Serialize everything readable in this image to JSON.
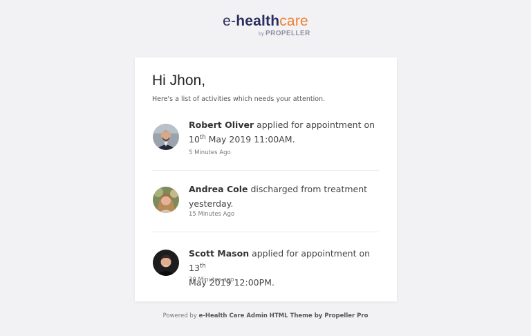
{
  "brand": {
    "logo_e": "e-",
    "logo_health": "health",
    "logo_care": "care",
    "sub_by": "by",
    "sub_name": "PROPELLER",
    "colors": {
      "navy": "#2a2d5e",
      "orange": "#f07f2d"
    }
  },
  "card": {
    "greeting": "Hi Jhon,",
    "intro": "Here's a list of activities which needs your attention."
  },
  "activities": [
    {
      "name": "Robert Oliver",
      "action": " applied for appointment on",
      "day": "10",
      "ordinal": "th",
      "rest": " May 2019 11:00AM.",
      "time": "5 Minutes Ago"
    },
    {
      "name": "Andrea Cole",
      "action": " discharged from treatment yesterday.",
      "time": "15 Minutes Ago"
    },
    {
      "name": "Scott Mason",
      "action": " applied for appointment on 13",
      "ordinal": "th",
      "rest": "May 2019 12:00PM.",
      "time": "30 Minutes ago"
    }
  ],
  "footer": {
    "prefix": "Powered by ",
    "link": "e-Health Care Admin HTML Theme by Propeller Pro"
  }
}
